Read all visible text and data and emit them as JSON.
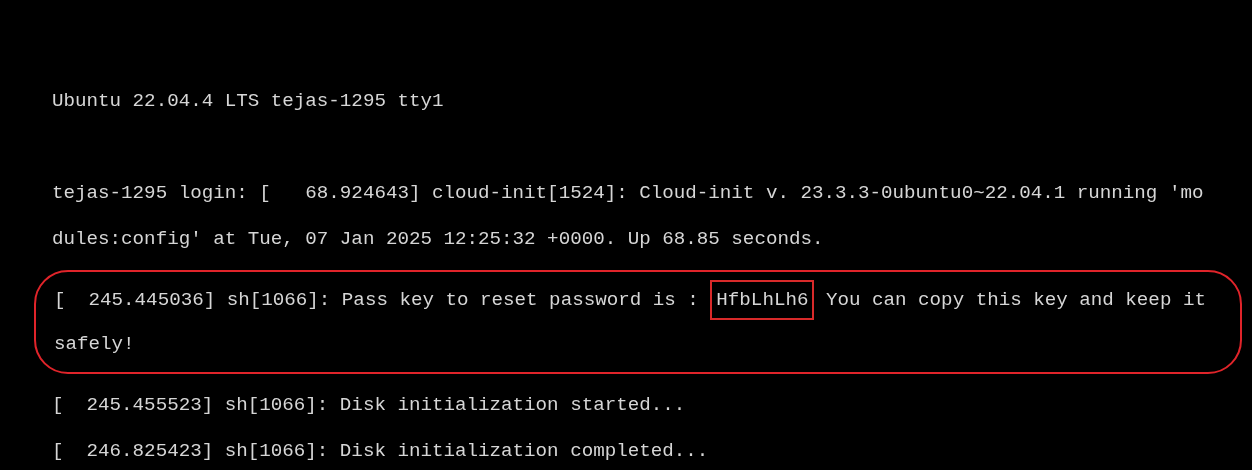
{
  "terminal": {
    "lines_before": [
      {
        "kind": "text",
        "text": "Ubuntu 22.04.4 LTS tejas-1295 tty1"
      },
      {
        "kind": "blank"
      },
      {
        "kind": "text",
        "text": "tejas-1295 login: [   68.924643] cloud-init[1524]: Cloud-init v. 23.3.3-0ubuntu0~22.04.1 running 'mo"
      },
      {
        "kind": "text",
        "text": "dules:config' at Tue, 07 Jan 2025 12:25:32 +0000. Up 68.85 seconds."
      }
    ],
    "highlighted": [
      {
        "kind": "key",
        "before": "[  245.445036] sh[1066]: Pass key to reset password is :",
        "key": "HfbLhLh6",
        "after": "You can copy this key and keep it"
      },
      {
        "kind": "text",
        "text": "safely!"
      }
    ],
    "lines_after": [
      {
        "kind": "text",
        "text": "[  245.455523] sh[1066]: Disk initialization started..."
      },
      {
        "kind": "text",
        "text": "[  246.825423] sh[1066]: Disk initialization completed..."
      }
    ]
  }
}
